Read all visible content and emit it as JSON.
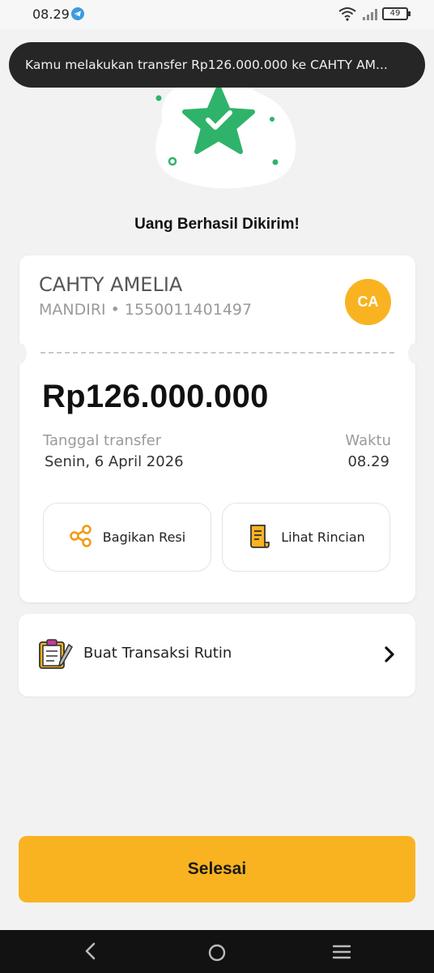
{
  "status_bar": {
    "time": "08.29",
    "battery": "49"
  },
  "toast": {
    "message": "Kamu melakukan transfer Rp126.000.000 ke CAHTY AM..."
  },
  "success_title": "Uang Berhasil Dikirim!",
  "receipt": {
    "recipient_name": "CAHTY AMELIA",
    "recipient_bank": "MANDIRI • 1550011401497",
    "avatar_initials": "CA",
    "amount": "Rp126.000.000",
    "date_label": "Tanggal transfer",
    "date_value": "Senin, 6 April 2026",
    "time_label": "Waktu",
    "time_value": "08.29",
    "share_label": "Bagikan Resi",
    "detail_label": "Lihat Rincian"
  },
  "routine": {
    "label": "Buat Transaksi Rutin"
  },
  "done_button": "Selesai",
  "colors": {
    "accent": "#f9b320",
    "success_green": "#2fb36b",
    "background": "#f2f2f2"
  },
  "icons": {
    "share": "share-icon",
    "detail": "receipt-icon",
    "routine": "clipboard-icon",
    "chevron": "chevron-right-icon",
    "back": "nav-back-icon",
    "home": "nav-home-icon",
    "menu": "nav-menu-icon"
  }
}
